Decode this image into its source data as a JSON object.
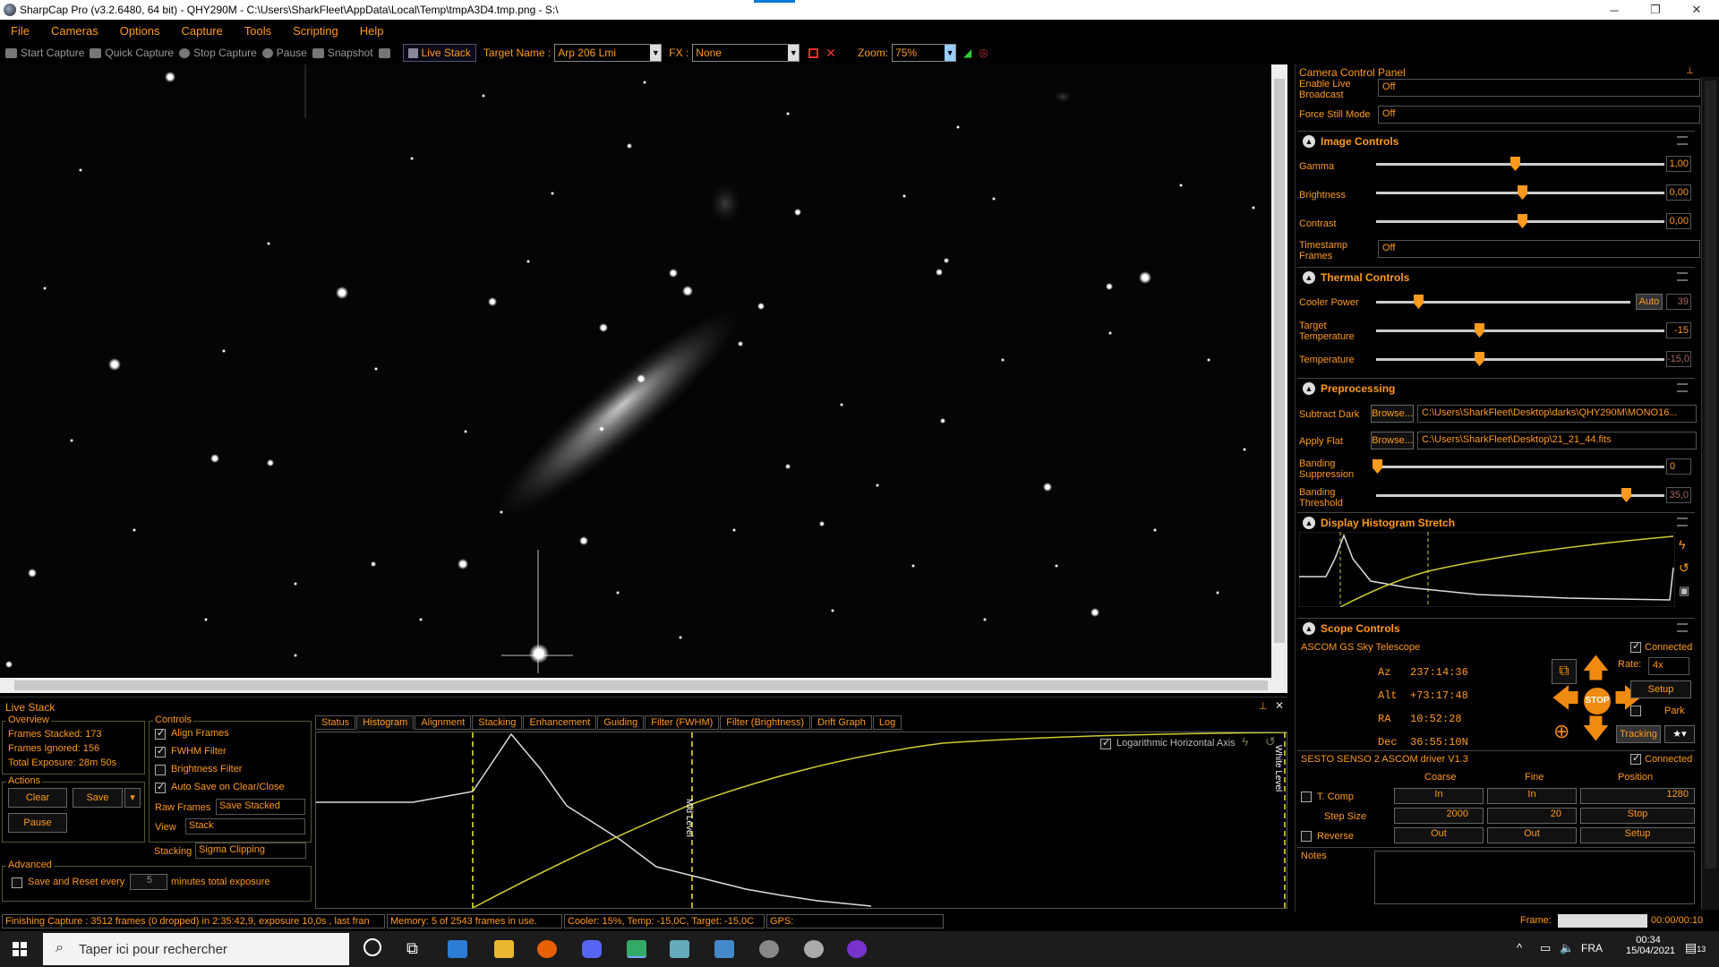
{
  "window": {
    "title": "SharpCap Pro (v3.2.6480, 64 bit) - QHY290M - C:\\Users\\SharkFleet\\AppData\\Local\\Temp\\tmpA3D4.tmp.png - S:\\"
  },
  "menu": [
    "File",
    "Cameras",
    "Options",
    "Capture",
    "Tools",
    "Scripting",
    "Help"
  ],
  "toolbar": {
    "start": "Start Capture",
    "quick": "Quick Capture",
    "stop": "Stop Capture",
    "pause": "Pause",
    "snapshot": "Snapshot",
    "live_stack": "Live Stack",
    "target_label": "Target Name :",
    "target_value": "Arp 206 Lmi",
    "fx_label": "FX :",
    "fx_value": "None",
    "zoom_label": "Zoom:",
    "zoom_value": "75%"
  },
  "ccp": {
    "title": "Camera Control Panel",
    "live_broadcast": {
      "label": "Enable Live Broadcast",
      "value": "Off"
    },
    "force_still": {
      "label": "Force Still Mode",
      "value": "Off"
    },
    "image_controls": {
      "title": "Image Controls",
      "gamma": {
        "label": "Gamma",
        "value": "1,00",
        "pos": 0.47
      },
      "brightness": {
        "label": "Brightness",
        "value": "0,00",
        "pos": 0.5
      },
      "contrast": {
        "label": "Contrast",
        "value": "0,00",
        "pos": 0.5
      },
      "timestamp": {
        "label": "Timestamp Frames",
        "value": "Off"
      }
    },
    "thermal": {
      "title": "Thermal Controls",
      "cooler": {
        "label": "Cooler Power",
        "auto": "Auto",
        "value": "39",
        "pos": 0.15
      },
      "target_temp": {
        "label": "Target Temperature",
        "value": "-15",
        "pos": 0.35
      },
      "temperature": {
        "label": "Temperature",
        "value": "-15,0",
        "pos": 0.35
      }
    },
    "preproc": {
      "title": "Preprocessing",
      "dark": {
        "label": "Subtract Dark",
        "browse": "Browse...",
        "value": "C:\\Users\\SharkFleet\\Desktop\\darks\\QHY290M\\MONO16..."
      },
      "flat": {
        "label": "Apply Flat",
        "browse": "Browse...",
        "value": "C:\\Users\\SharkFleet\\Desktop\\21_21_44.fits"
      },
      "banding_supp": {
        "label": "Banding Suppression",
        "value": "0",
        "pos": 0.0
      },
      "banding_thr": {
        "label": "Banding Threshold",
        "value": "35,0",
        "pos": 0.87
      }
    },
    "histogram": {
      "title": "Display Histogram Stretch"
    },
    "scope": {
      "title": "Scope Controls",
      "name": "ASCOM GS Sky Telescope",
      "connected": "Connected",
      "az_label": "Az",
      "az": "237:14:36",
      "alt_label": "Alt",
      "alt": "+73:17:48",
      "ra_label": "RA",
      "ra": "10:52:28",
      "dec_label": "Dec",
      "dec": "36:55:10N",
      "rate_label": "Rate:",
      "rate": "4x",
      "setup": "Setup",
      "park": "Park",
      "tracking": "Tracking",
      "stop": "STOP"
    },
    "focuser": {
      "name": "SESTO SENSO 2 ASCOM driver V1.3",
      "connected": "Connected",
      "coarse": "Coarse",
      "fine": "Fine",
      "position": "Position",
      "tcomp": "T. Comp",
      "in": "In",
      "pos_value": "1280",
      "step_label": "Step Size",
      "step_coarse": "2000",
      "step_fine": "20",
      "stop": "Stop",
      "reverse": "Reverse",
      "out": "Out",
      "setup": "Setup"
    },
    "notes": "Notes"
  },
  "livestack": {
    "title": "Live Stack",
    "overview": {
      "title": "Overview",
      "stacked": "Frames Stacked: 173",
      "ignored": "Frames Ignored: 156",
      "exposure": "Total Exposure: 28m 50s"
    },
    "actions": {
      "title": "Actions",
      "clear": "Clear",
      "save": "Save",
      "pause": "Pause"
    },
    "controls": {
      "title": "Controls",
      "align": "Align Frames",
      "fwhm": "FWHM Filter",
      "bright": "Brightness Filter",
      "autosave": "Auto Save on Clear/Close",
      "raw_label": "Raw Frames",
      "raw_value": "Save Stacked",
      "view_label": "View",
      "view_value": "Stack",
      "stacking_label": "Stacking",
      "stacking_value": "Sigma Clipping"
    },
    "advanced": {
      "title": "Advanced",
      "save_reset": "Save and Reset every",
      "minutes": "5",
      "minutes_label": "minutes total exposure"
    },
    "tabs": [
      "Status",
      "Histogram",
      "Alignment",
      "Stacking",
      "Enhancement",
      "Guiding",
      "Filter (FWHM)",
      "Filter (Brightness)",
      "Drift Graph",
      "Log"
    ],
    "active_tab": "Histogram",
    "hist": {
      "log_axis": "Logarithmic Horizontal Axis",
      "black": "Black Level",
      "mid": "Mid Level",
      "white": "White Level"
    }
  },
  "status": {
    "capture": "Finishing Capture : 3512 frames (0 dropped) in 2:35:42,9, exposure 10,0s , last fran",
    "memory": "Memory: 5 of 2543 frames in use.",
    "cooler": "Cooler: 15%, Temp: -15,0C, Target: -15,0C",
    "gps": "GPS:",
    "frame_label": "Frame:",
    "frame_time": "00:00/00:10"
  },
  "taskbar": {
    "search": "Taper ici pour rechercher",
    "lang": "FRA",
    "time": "00:34",
    "date": "15/04/2021",
    "notif": "13"
  },
  "colors": {
    "accent": "#ff9a1e",
    "scope_arrow": "#f08a10"
  }
}
